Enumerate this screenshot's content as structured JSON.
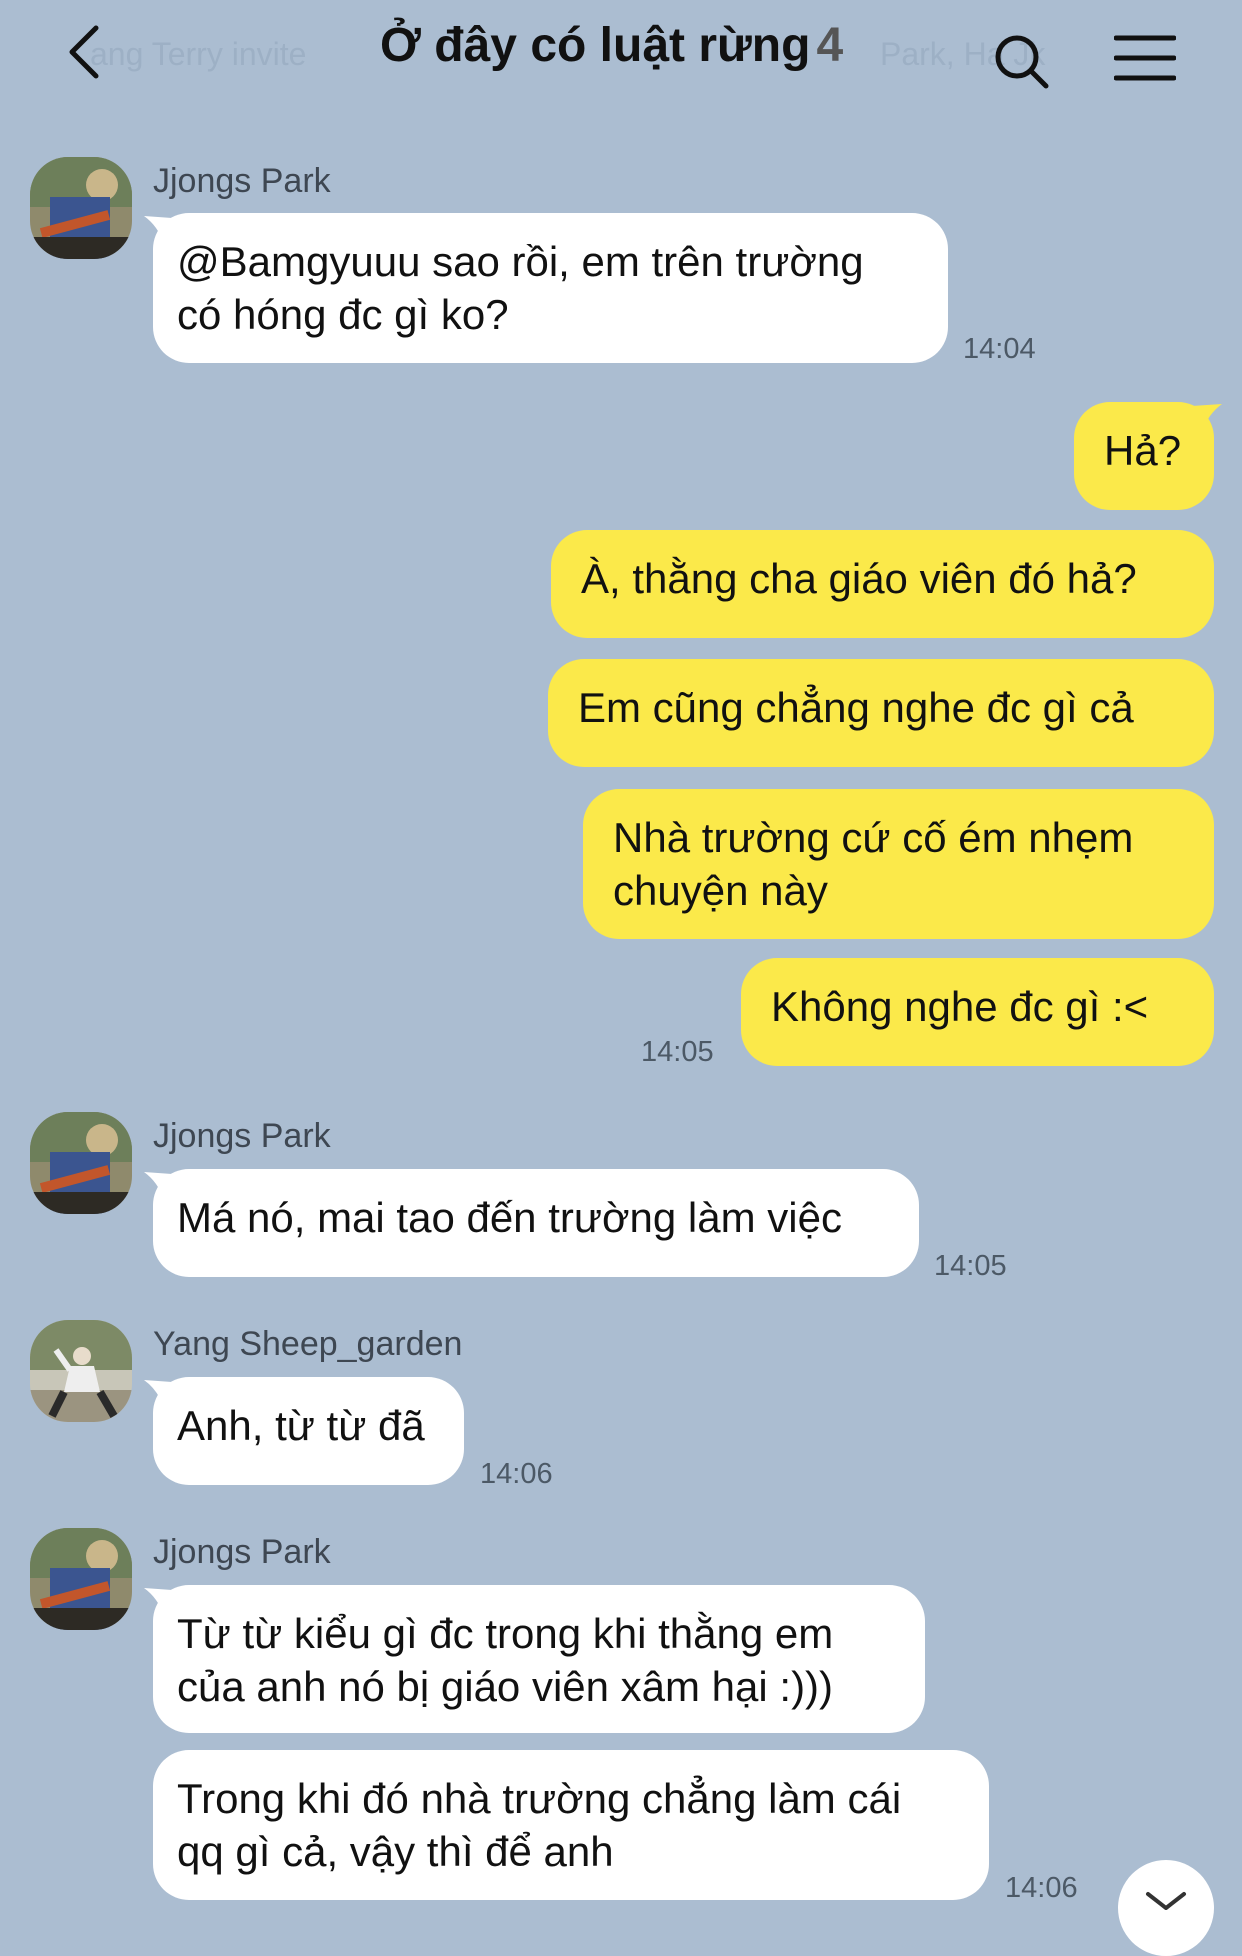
{
  "header": {
    "title": "Ở đây có luật rừng",
    "member_count": "4",
    "ghost_left": "ang Terry invite",
    "ghost_right": "Park, Ha Jk"
  },
  "colors": {
    "background": "#abbdd1",
    "bubble_in": "#ffffff",
    "bubble_out": "#fbe94a"
  },
  "messages": [
    {
      "sender": "Jjongs Park",
      "text": "@Bamgyuuu sao rồi, em trên trường\ncó hóng đc gì ko?",
      "time": "14:04"
    },
    {
      "text": "Hả?"
    },
    {
      "text": "À, thằng cha giáo viên đó hả?"
    },
    {
      "text": "Em cũng chẳng nghe đc gì cả"
    },
    {
      "text": "Nhà trường cứ cố ém nhẹm\nchuyện này"
    },
    {
      "text": "Không nghe đc gì :<",
      "time": "14:05"
    },
    {
      "sender": "Jjongs Park",
      "text": "Má nó, mai tao đến trường làm việc",
      "time": "14:05"
    },
    {
      "sender": "Yang Sheep_garden",
      "text": "Anh, từ từ đã",
      "time": "14:06"
    },
    {
      "sender": "Jjongs Park",
      "text": "Từ từ kiểu gì đc trong khi thằng em\ncủa anh nó bị giáo viên xâm hại :)))"
    },
    {
      "text": "Trong khi đó nhà trường chẳng làm cái\nqq gì cả, vậy thì để anh",
      "time": "14:06"
    }
  ],
  "icons": {
    "back": "chevron-left-icon",
    "search": "search-icon",
    "menu": "menu-icon",
    "scroll_down": "chevron-down-icon"
  }
}
